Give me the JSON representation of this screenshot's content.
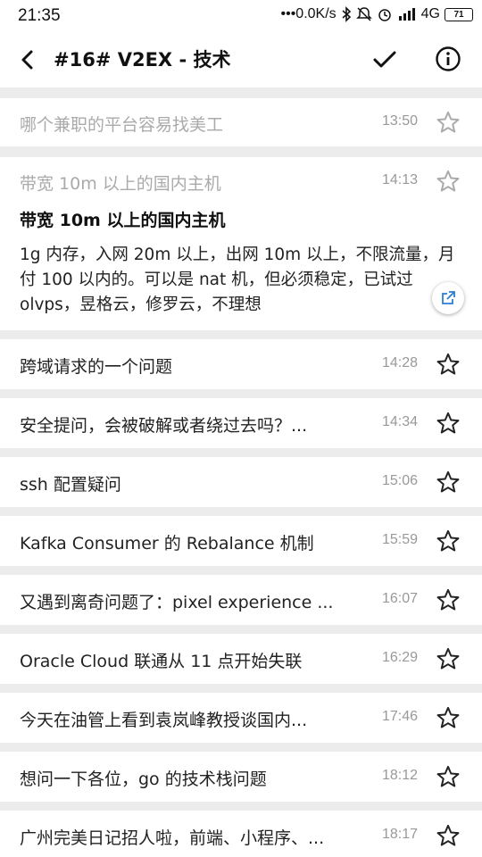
{
  "status_bar": {
    "time": "21:35",
    "network_speed": "•••0.0K/s",
    "signal_label": "4G",
    "battery": "71"
  },
  "app_bar": {
    "title": "#16# V2EX - 技术",
    "icons": [
      "back-arrow-icon",
      "check-icon",
      "info-icon"
    ]
  },
  "detail": {
    "heading": "带宽 10m 以上的国内主机",
    "body": "1g 内存，入网 20m 以上，出网 10m 以上，不限流量，月付 100 以内的。可以是 nat 机，但必须稳定，已试过 olvps，昱格云，修罗云，不理想"
  },
  "topics": [
    {
      "title": "哪个兼职的平台容易找美工",
      "time": "13:50",
      "read": true
    },
    {
      "title": "带宽 10m 以上的国内主机",
      "time": "14:13",
      "read": true
    },
    {
      "title": "跨域请求的一个问题",
      "time": "14:28",
      "read": false
    },
    {
      "title": "安全提问，会被破解或者绕过去吗？...",
      "time": "14:34",
      "read": false
    },
    {
      "title": "ssh 配置疑问",
      "time": "15:06",
      "read": false
    },
    {
      "title": "Kafka Consumer 的 Rebalance 机制",
      "time": "15:59",
      "read": false
    },
    {
      "title": "又遇到离奇问题了：pixel experience ...",
      "time": "16:07",
      "read": false
    },
    {
      "title": "Oracle Cloud 联通从 11 点开始失联",
      "time": "16:29",
      "read": false
    },
    {
      "title": "今天在油管上看到袁岚峰教授谈国内...",
      "time": "17:46",
      "read": false
    },
    {
      "title": "想问一下各位，go 的技术栈问题",
      "time": "18:12",
      "read": false
    },
    {
      "title": "广州完美日记招人啦，前端、小程序、...",
      "time": "18:17",
      "read": false
    }
  ],
  "colors": {
    "background": "#ececec",
    "card": "#ffffff",
    "read_text": "#aaaaaa",
    "accent": "#2a7fd4"
  }
}
